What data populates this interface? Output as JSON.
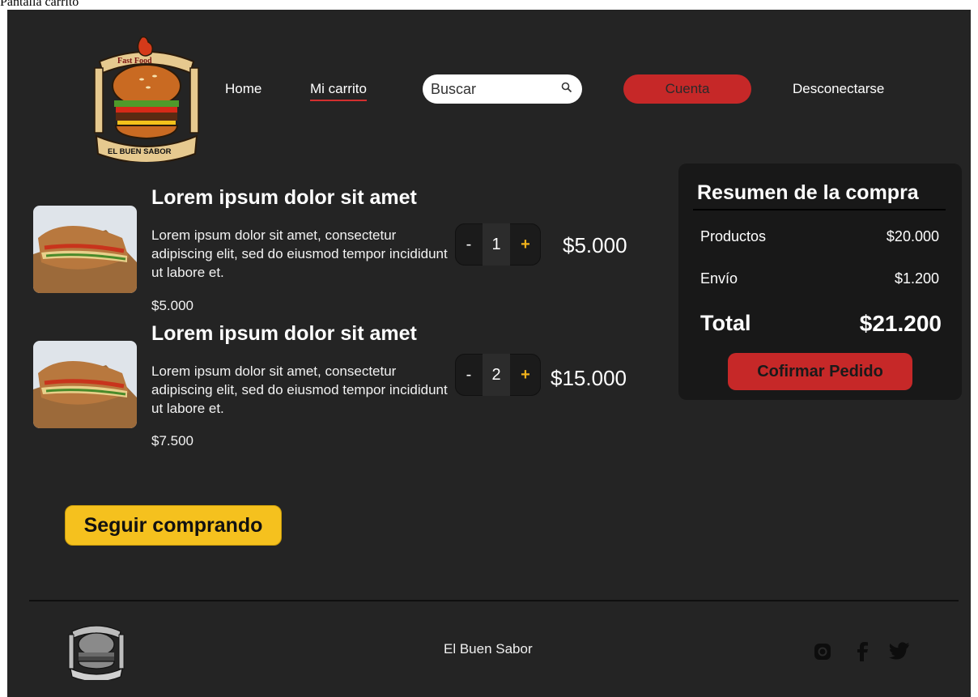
{
  "frame_caption": "Pantalla carrito",
  "header": {
    "logo": {
      "top_text": "Fast Food",
      "banner_text": "EL BUEN SABOR"
    },
    "nav": {
      "home": "Home",
      "cart": "Mi carrito",
      "logout": "Desconectarse"
    },
    "search": {
      "placeholder": "Buscar",
      "icon": "search-icon"
    },
    "account_button": "Cuenta"
  },
  "cart": {
    "items": [
      {
        "title": "Lorem ipsum dolor sit amet",
        "description": "Lorem ipsum dolor sit amet, consectetur adipiscing elit, sed do eiusmod tempor incididunt ut labore et.",
        "unit_price": "$5.000",
        "quantity": "1",
        "total": "$5.000",
        "minus": "-",
        "plus": "+"
      },
      {
        "title": "Lorem ipsum dolor sit amet",
        "description": "Lorem ipsum dolor sit amet, consectetur adipiscing elit, sed do eiusmod tempor incididunt ut labore et.",
        "unit_price": "$7.500",
        "quantity": "2",
        "total": "$15.000",
        "minus": "-",
        "plus": "+"
      }
    ],
    "continue_button": "Seguir comprando"
  },
  "summary": {
    "title": "Resumen de la compra",
    "products_label": "Productos",
    "products_value": "$20.000",
    "shipping_label": "Envío",
    "shipping_value": "$1.200",
    "total_label": "Total",
    "total_value": "$21.200",
    "confirm_button": "Cofirmar Pedido"
  },
  "footer": {
    "brand": "El Buen Sabor",
    "social_icons": [
      "instagram-icon",
      "facebook-icon",
      "twitter-icon"
    ]
  },
  "colors": {
    "background": "#242424",
    "panel": "#181818",
    "accent_red": "#c62828",
    "accent_yellow": "#f5c11e"
  }
}
